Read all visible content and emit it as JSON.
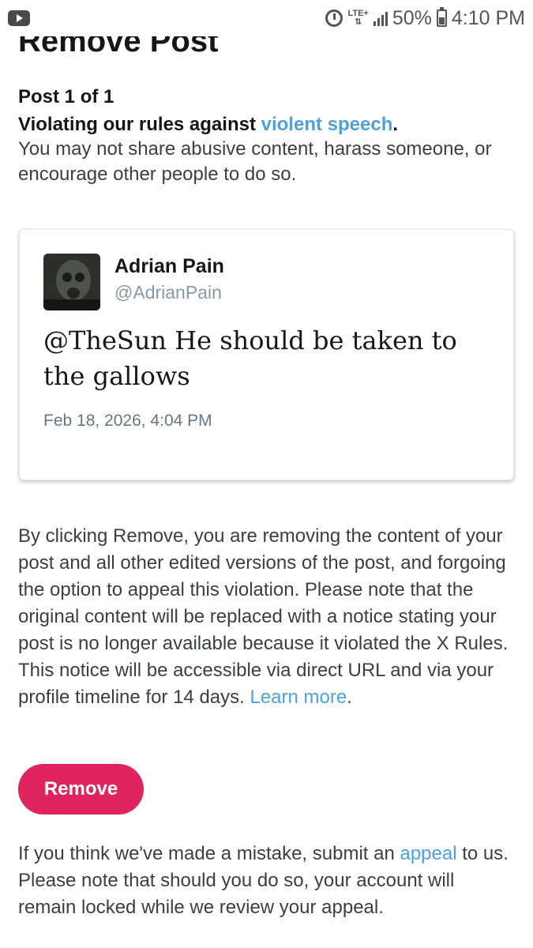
{
  "status_bar": {
    "network": "LTE+",
    "battery": "50%",
    "time": "4:10 PM",
    "icons": [
      "youtube-icon",
      "alarm-icon",
      "signal-icon",
      "battery-icon"
    ]
  },
  "page": {
    "title": "Remove Post",
    "post_count": "Post 1 of 1",
    "rule_prefix": "Violating our rules against ",
    "rule_link": "violent speech",
    "rule_suffix": ".",
    "rule_description": "You may not share abusive content, harass someone, or encourage other people to do so."
  },
  "post": {
    "author_name": "Adrian Pain",
    "author_handle": "@AdrianPain",
    "text": "@TheSun He should be taken to the gallows",
    "timestamp": "Feb 18, 2026, 4:04 PM"
  },
  "removal": {
    "info_text": "By clicking Remove, you are removing the content of your post and all other edited versions of the post, and forgoing the option to appeal this violation. Please note that the original content will be replaced with a notice stating your post is no longer available because it violated the X Rules. This notice will be accessible via direct URL and via your profile timeline for 14 days. ",
    "learn_more_link": "Learn more",
    "info_suffix": ".",
    "button_label": "Remove"
  },
  "appeal": {
    "prefix": "If you think we've made a mistake, submit an ",
    "link": "appeal",
    "suffix": " to us. Please note that should you do so, your account will remain locked while we review your appeal."
  },
  "colors": {
    "link": "#4da1dc",
    "remove_button": "#e0245e",
    "text": "#14171a"
  }
}
